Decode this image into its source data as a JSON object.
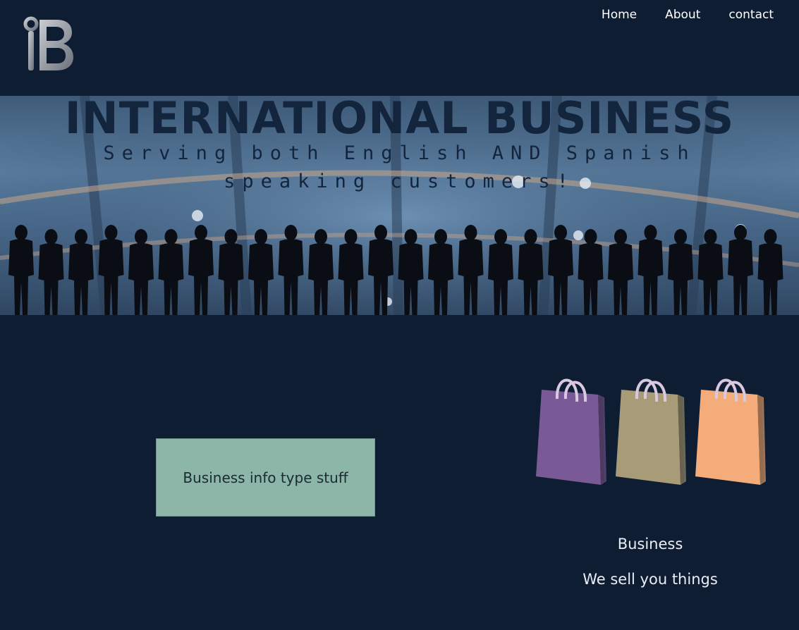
{
  "logo": {
    "text": "IB"
  },
  "nav": {
    "items": [
      "Home",
      "About",
      "contact"
    ]
  },
  "hero": {
    "title": "INTERNATIONAL BUSINESS",
    "subtitle": "Serving both English AND Spanish speaking customers!"
  },
  "info_box": {
    "text": "Business info type stuff"
  },
  "bags": {
    "colors": [
      "#7a5a96",
      "#a89c78",
      "#f4ad7a"
    ]
  },
  "side": {
    "title": "Business",
    "tagline": "We sell you things"
  },
  "colors": {
    "background": "#0f1d33",
    "info_box": "#8cb6a8",
    "hero_text": "#13243d"
  }
}
